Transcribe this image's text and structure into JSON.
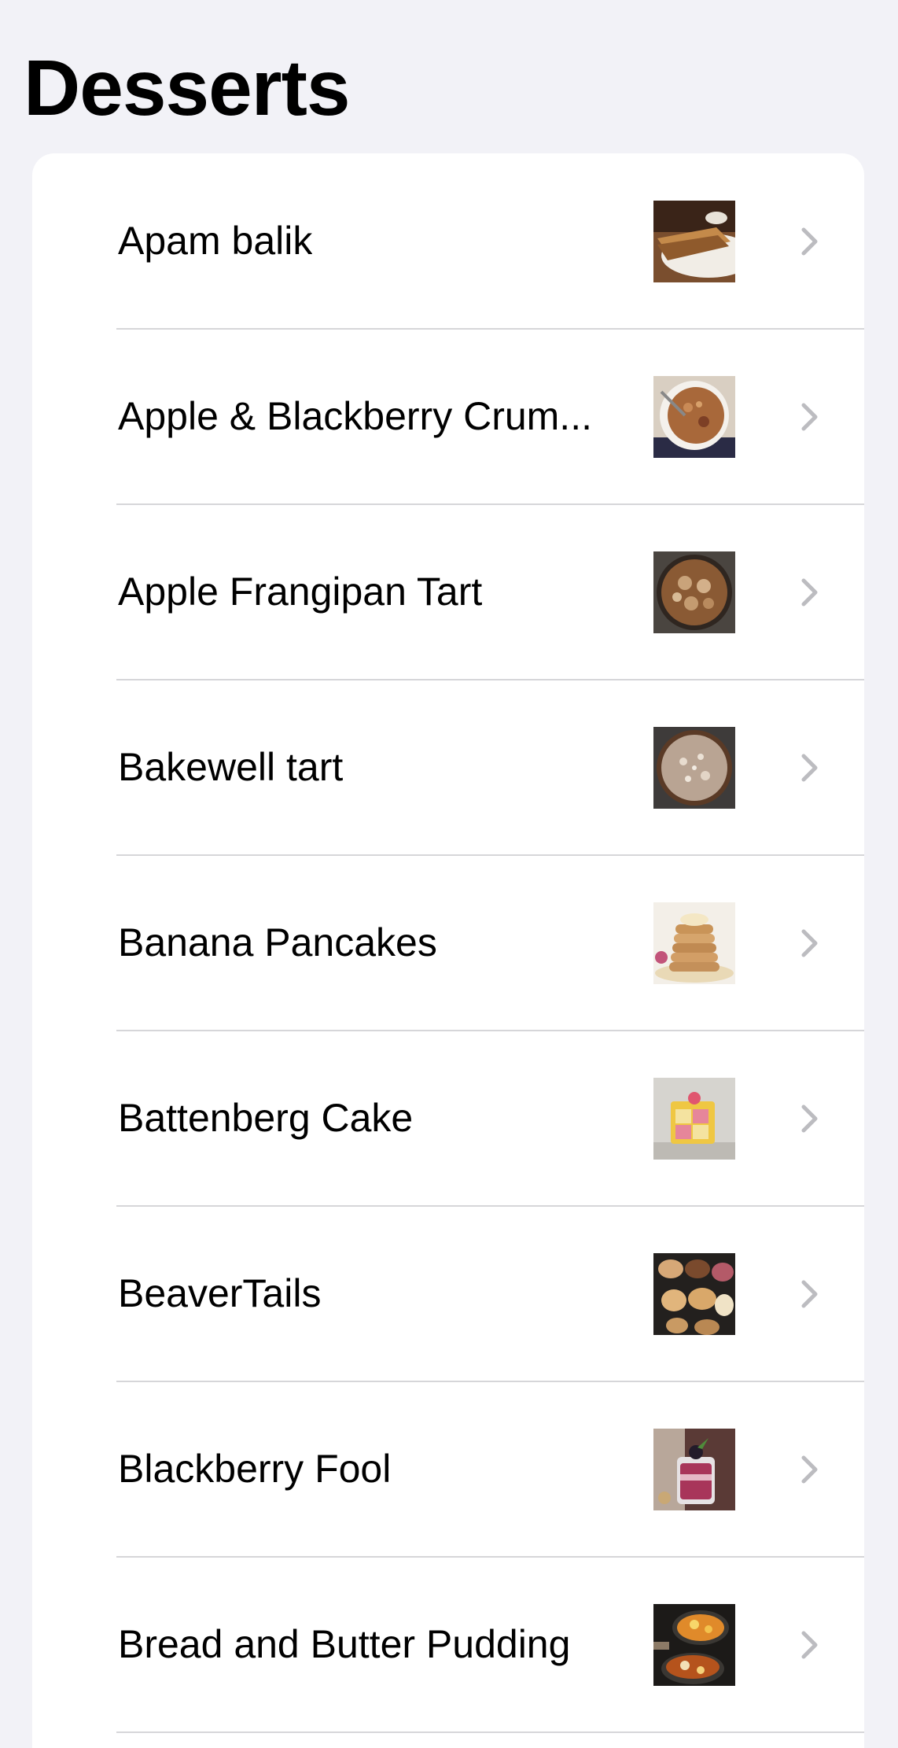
{
  "page": {
    "title": "Desserts"
  },
  "desserts": [
    {
      "name": "Apam balik",
      "thumb_icon": "apam-balik-photo"
    },
    {
      "name": "Apple & Blackberry Crum...",
      "thumb_icon": "crumble-photo"
    },
    {
      "name": "Apple Frangipan Tart",
      "thumb_icon": "frangipan-tart-photo"
    },
    {
      "name": "Bakewell tart",
      "thumb_icon": "bakewell-tart-photo"
    },
    {
      "name": "Banana Pancakes",
      "thumb_icon": "pancakes-photo"
    },
    {
      "name": "Battenberg Cake",
      "thumb_icon": "battenberg-photo"
    },
    {
      "name": "BeaverTails",
      "thumb_icon": "beavertails-photo"
    },
    {
      "name": "Blackberry Fool",
      "thumb_icon": "blackberry-fool-photo"
    },
    {
      "name": "Bread and Butter Pudding",
      "thumb_icon": "bread-pudding-photo"
    }
  ],
  "colors": {
    "background": "#f2f2f7",
    "card": "#ffffff",
    "separator": "#d6d6d9",
    "chevron": "#bcbcc0",
    "text": "#000000"
  }
}
